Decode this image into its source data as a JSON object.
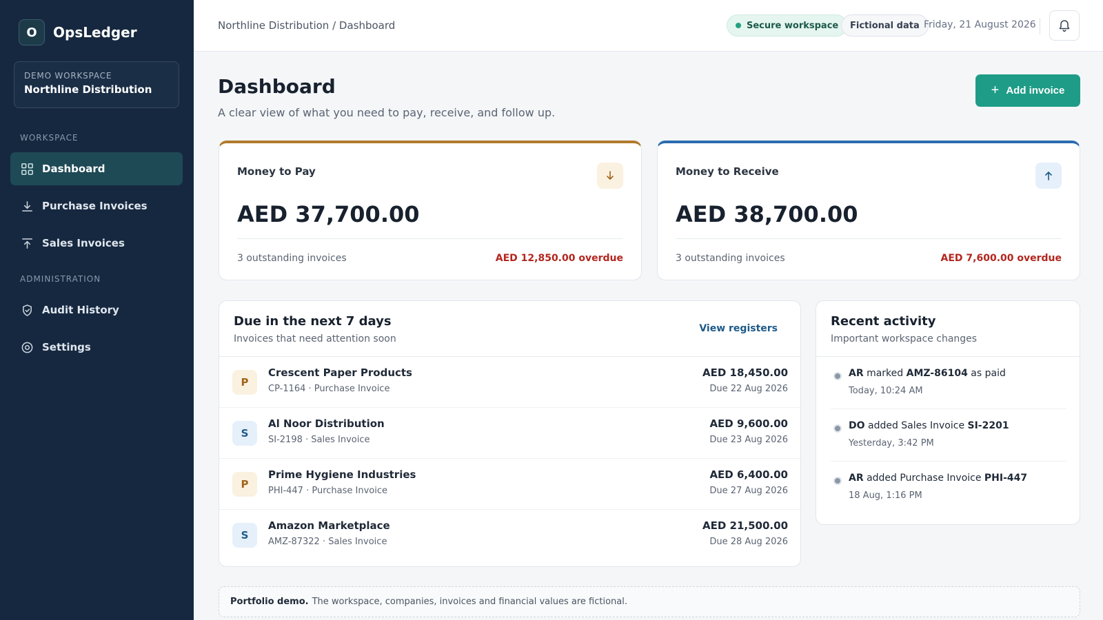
{
  "app": {
    "logo_letter": "O",
    "name": "OpsLedger"
  },
  "workspace": {
    "label": "DEMO WORKSPACE",
    "name": "Northline Distribution"
  },
  "nav": {
    "section_workspace": "WORKSPACE",
    "section_admin": "ADMINISTRATION",
    "items": [
      {
        "label": "Dashboard",
        "icon": "grid-icon",
        "active": true
      },
      {
        "label": "Purchase Invoices",
        "icon": "download-icon"
      },
      {
        "label": "Sales Invoices",
        "icon": "upload-icon"
      },
      {
        "label": "Audit History",
        "icon": "shield-icon"
      },
      {
        "label": "Settings",
        "icon": "gear-icon"
      }
    ]
  },
  "topbar": {
    "breadcrumb": "Northline Distribution / Dashboard",
    "secure_pill": "Secure workspace",
    "fictional_pill": "Fictional data",
    "date": "Friday, 21 August 2026",
    "bell_icon": "bell-icon"
  },
  "header": {
    "title": "Dashboard",
    "subtitle": "A clear view of what you need to pay, receive, and follow up.",
    "add_button_icon": "+",
    "add_button": "Add invoice"
  },
  "summary": {
    "pay": {
      "title": "Money to Pay",
      "amount": "AED 37,700.00",
      "count": "3 outstanding invoices",
      "overdue": "AED 12,850.00 overdue",
      "icon": "arrow-down-icon",
      "accent": "#b07a2c"
    },
    "receive": {
      "title": "Money to Receive",
      "amount": "AED 38,700.00",
      "count": "3 outstanding invoices",
      "overdue": "AED 7,600.00 overdue",
      "icon": "arrow-up-icon",
      "accent": "#2a6cb0"
    }
  },
  "due": {
    "title": "Due in the next 7 days",
    "subtitle": "Invoices that need attention soon",
    "link": "View registers",
    "rows": [
      {
        "badge": "P",
        "name": "Crescent Paper Products",
        "meta": "CP-1164 · Purchase Invoice",
        "amount": "AED 18,450.00",
        "due": "Due 22 Aug 2026"
      },
      {
        "badge": "S",
        "name": "Al Noor Distribution",
        "meta": "SI-2198 · Sales Invoice",
        "amount": "AED 9,600.00",
        "due": "Due 23 Aug 2026"
      },
      {
        "badge": "P",
        "name": "Prime Hygiene Industries",
        "meta": "PHI-447 · Purchase Invoice",
        "amount": "AED 6,400.00",
        "due": "Due 27 Aug 2026"
      },
      {
        "badge": "S",
        "name": "Amazon Marketplace",
        "meta": "AMZ-87322 · Sales Invoice",
        "amount": "AED 21,500.00",
        "due": "Due 28 Aug 2026"
      }
    ]
  },
  "activity": {
    "title": "Recent activity",
    "subtitle": "Important workspace changes",
    "items": [
      {
        "user": "AR",
        "action": "marked",
        "ref": "AMZ-86104",
        "suffix": "as paid",
        "time": "Today, 10:24 AM"
      },
      {
        "user": "DO",
        "action": "added Sales Invoice",
        "ref": "SI-2201",
        "suffix": "",
        "time": "Yesterday, 3:42 PM"
      },
      {
        "user": "AR",
        "action": "added Purchase Invoice",
        "ref": "PHI-447",
        "suffix": "",
        "time": "18 Aug, 1:16 PM"
      }
    ]
  },
  "footer": {
    "strong": "Portfolio demo.",
    "text": "The workspace, companies, invoices and financial values are fictional."
  }
}
